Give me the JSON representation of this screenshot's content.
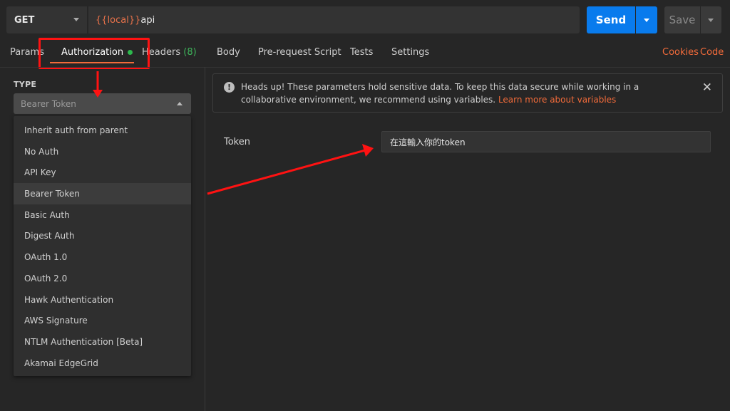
{
  "request": {
    "method": "GET",
    "url_variable": "{{local}}",
    "url_path": "api",
    "send_label": "Send",
    "save_label": "Save"
  },
  "tabs": {
    "params": "Params",
    "authorization": "Authorization",
    "headers": "Headers",
    "headers_count": "(8)",
    "body": "Body",
    "pre_request_script": "Pre-request Script",
    "tests": "Tests",
    "settings": "Settings",
    "cookies": "Cookies",
    "code": "Code"
  },
  "auth": {
    "type_label": "TYPE",
    "selected_type": "Bearer Token",
    "options": [
      "Inherit auth from parent",
      "No Auth",
      "API Key",
      "Bearer Token",
      "Basic Auth",
      "Digest Auth",
      "OAuth 1.0",
      "OAuth 2.0",
      "Hawk Authentication",
      "AWS Signature",
      "NTLM Authentication [Beta]",
      "Akamai EdgeGrid"
    ]
  },
  "alert": {
    "icon": "exclamation-icon",
    "text": "Heads up! These parameters hold sensitive data. To keep this data secure while working in a collaborative environment, we recommend using variables.",
    "link": "Learn more about variables"
  },
  "token": {
    "label": "Token",
    "value": "在這輸入你的token"
  },
  "colors": {
    "accent": "#f26b3a",
    "send_button": "#097bed",
    "annotation": "#ff1212",
    "status_dot": "#2db84d"
  }
}
